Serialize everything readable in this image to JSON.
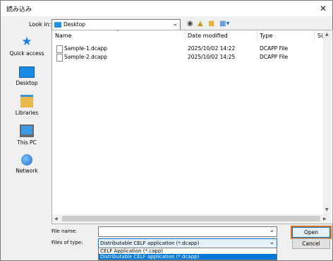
{
  "window": {
    "title": "読み込み",
    "close": "✕"
  },
  "toolbar": {
    "lookin_label": "Look in:",
    "lookin_value": "Desktop"
  },
  "places": [
    {
      "label": "Quick access",
      "icon": "star-icon"
    },
    {
      "label": "Desktop",
      "icon": "desktop-icon"
    },
    {
      "label": "Libraries",
      "icon": "libraries-icon"
    },
    {
      "label": "This PC",
      "icon": "computer-icon"
    },
    {
      "label": "Network",
      "icon": "network-icon"
    }
  ],
  "columns": {
    "name": "Name",
    "date": "Date modified",
    "type": "Type",
    "size": "Size"
  },
  "files": [
    {
      "name": "Sample-1.dcapp",
      "date": "2025/10/02 14:22",
      "type": "DCAPP File"
    },
    {
      "name": "Sample-2.dcapp",
      "date": "2025/10/02 14:25",
      "type": "DCAPP File"
    }
  ],
  "bottom": {
    "filename_label": "File name:",
    "filename_value": "",
    "filetype_label": "Files of type:",
    "filetype_value": "Distributable CELF application (*.dcapp)",
    "options": [
      "CELF Application (*.capp)",
      "Distributable CELF application (*.dcapp)"
    ],
    "open_label": "Open",
    "cancel_label": "Cancel"
  },
  "colors": {
    "accent": "#0078d7",
    "highlight": "#e06f1f"
  }
}
